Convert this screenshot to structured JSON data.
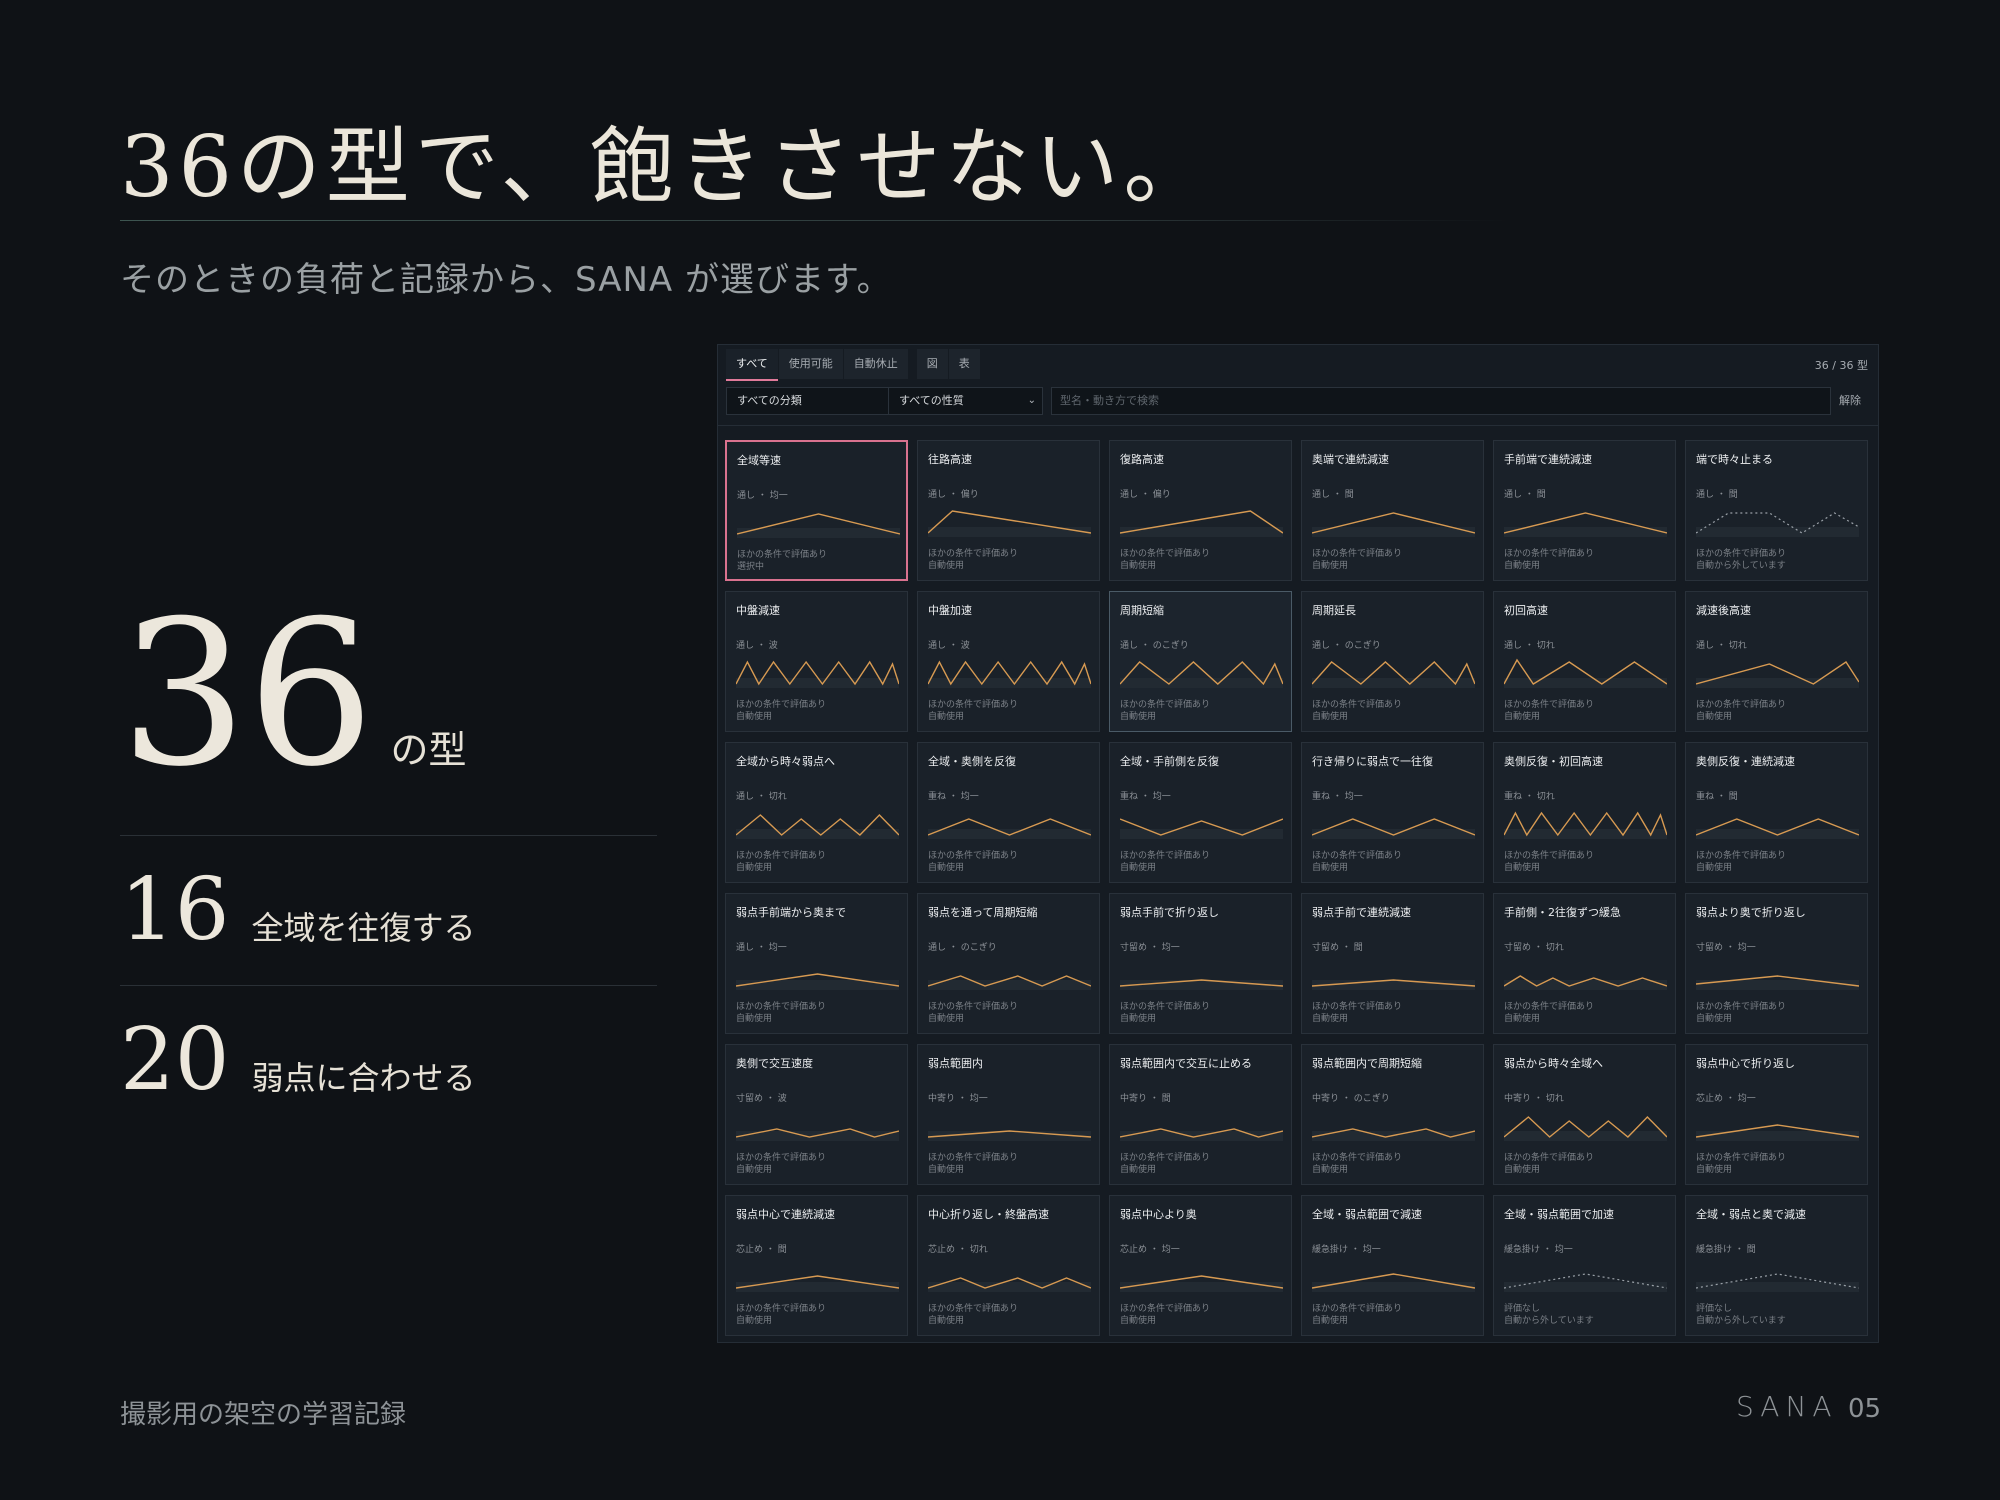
{
  "headline": "36の型で、飽きさせない。",
  "subline": "そのときの負荷と記録から、SANA が選びます。",
  "stats": {
    "total": {
      "num": "36",
      "label": "の型"
    },
    "round": {
      "num": "16",
      "label": "全域を往復する"
    },
    "weak": {
      "num": "20",
      "label": "弱点に合わせる"
    }
  },
  "footer": {
    "note": "撮影用の架空の学習記録",
    "brand": "SANA",
    "page": "05"
  },
  "colors": {
    "background": "#0f1216",
    "accent": "#e07a9a",
    "line": "#d79a52",
    "dotted": "#9aa1a8"
  },
  "panel": {
    "tabs": [
      "すべて",
      "使用可能",
      "自動休止"
    ],
    "view_tabs": [
      "図",
      "表"
    ],
    "count": "36 / 36 型",
    "category_select": "すべての分類",
    "property_select": "すべての性質",
    "search_placeholder": "型名・動き方で検索",
    "clear": "解除",
    "cards": [
      {
        "title": "全域等速",
        "sub": "通し ・ 均一",
        "e1": "ほかの条件で評価あり",
        "e2": "選択中",
        "selected": true,
        "wave": "tri"
      },
      {
        "title": "往路高速",
        "sub": "通し ・ 偏り",
        "e1": "ほかの条件で評価あり",
        "e2": "自動使用",
        "wave": "fast"
      },
      {
        "title": "復路高速",
        "sub": "通し ・ 偏り",
        "e1": "ほかの条件で評価あり",
        "e2": "自動使用",
        "wave": "slow"
      },
      {
        "title": "奥端で連続減速",
        "sub": "通し ・ 間",
        "e1": "ほかの条件で評価あり",
        "e2": "自動使用",
        "wave": "tri"
      },
      {
        "title": "手前端で連続減速",
        "sub": "通し ・ 間",
        "e1": "ほかの条件で評価あり",
        "e2": "自動使用",
        "wave": "tri"
      },
      {
        "title": "端で時々止まる",
        "sub": "通し ・ 間",
        "e1": "ほかの条件で評価あり",
        "e2": "自動から外しています",
        "wave": "dotm",
        "dotted": true
      },
      {
        "title": "中盤減速",
        "sub": "通し ・ 波",
        "e1": "ほかの条件で評価あり",
        "e2": "自動使用",
        "wave": "zig6"
      },
      {
        "title": "中盤加速",
        "sub": "通し ・ 波",
        "e1": "ほかの条件で評価あり",
        "e2": "自動使用",
        "wave": "zig6"
      },
      {
        "title": "周期短縮",
        "sub": "通し ・ のこぎり",
        "e1": "ほかの条件で評価あり",
        "e2": "自動使用",
        "hover": true,
        "wave": "zig4"
      },
      {
        "title": "周期延長",
        "sub": "通し ・ のこぎり",
        "e1": "ほかの条件で評価あり",
        "e2": "自動使用",
        "wave": "zig4"
      },
      {
        "title": "初回高速",
        "sub": "通し ・ 切れ",
        "e1": "ほかの条件で評価あり",
        "e2": "自動使用",
        "wave": "zig3"
      },
      {
        "title": "減速後高速",
        "sub": "通し ・ 切れ",
        "e1": "ほかの条件で評価あり",
        "e2": "自動使用",
        "wave": "tri2"
      },
      {
        "title": "全域から時々弱点へ",
        "sub": "通し ・ 切れ",
        "e1": "ほかの条件で評価あり",
        "e2": "自動使用",
        "wave": "zig5"
      },
      {
        "title": "全域・奥側を反復",
        "sub": "重ね ・ 均一",
        "e1": "ほかの条件で評価あり",
        "e2": "自動使用",
        "wave": "m"
      },
      {
        "title": "全域・手前側を反復",
        "sub": "重ね ・ 均一",
        "e1": "ほかの条件で評価あり",
        "e2": "自動使用",
        "wave": "w"
      },
      {
        "title": "行き帰りに弱点で一往復",
        "sub": "重ね ・ 均一",
        "e1": "ほかの条件で評価あり",
        "e2": "自動使用",
        "wave": "m"
      },
      {
        "title": "奥側反復・初回高速",
        "sub": "重ね ・ 切れ",
        "e1": "ほかの条件で評価あり",
        "e2": "自動使用",
        "wave": "zig6"
      },
      {
        "title": "奥側反復・連続減速",
        "sub": "重ね ・ 間",
        "e1": "ほかの条件で評価あり",
        "e2": "自動使用",
        "wave": "m"
      },
      {
        "title": "弱点手前端から奥まで",
        "sub": "通し ・ 均一",
        "e1": "ほかの条件で評価あり",
        "e2": "自動使用",
        "wave": "low"
      },
      {
        "title": "弱点を通って周期短縮",
        "sub": "通し ・ のこぎり",
        "e1": "ほかの条件で評価あり",
        "e2": "自動使用",
        "wave": "lowzig"
      },
      {
        "title": "弱点手前で折り返し",
        "sub": "寸留め ・ 均一",
        "e1": "ほかの条件で評価あり",
        "e2": "自動使用",
        "wave": "flat"
      },
      {
        "title": "弱点手前で連続減速",
        "sub": "寸留め ・ 間",
        "e1": "ほかの条件で評価あり",
        "e2": "自動使用",
        "wave": "flat"
      },
      {
        "title": "手前側・2往復ずつ緩急",
        "sub": "寸留め ・ 切れ",
        "e1": "ほかの条件で評価あり",
        "e2": "自動使用",
        "wave": "smallzig"
      },
      {
        "title": "弱点より奥で折り返し",
        "sub": "寸留め ・ 均一",
        "e1": "ほかの条件で評価あり",
        "e2": "自動使用",
        "wave": "flat2"
      },
      {
        "title": "奥側で交互速度",
        "sub": "寸留め ・ 波",
        "e1": "ほかの条件で評価あり",
        "e2": "自動使用",
        "wave": "smallzig2"
      },
      {
        "title": "弱点範囲内",
        "sub": "中寄り ・ 均一",
        "e1": "ほかの条件で評価あり",
        "e2": "自動使用",
        "wave": "flat"
      },
      {
        "title": "弱点範囲内で交互に止める",
        "sub": "中寄り ・ 間",
        "e1": "ほかの条件で評価あり",
        "e2": "自動使用",
        "wave": "smallzig2"
      },
      {
        "title": "弱点範囲内で周期短縮",
        "sub": "中寄り ・ のこぎり",
        "e1": "ほかの条件で評価あり",
        "e2": "自動使用",
        "wave": "smallzig2"
      },
      {
        "title": "弱点から時々全域へ",
        "sub": "中寄り ・ 切れ",
        "e1": "ほかの条件で評価あり",
        "e2": "自動使用",
        "wave": "zig5"
      },
      {
        "title": "弱点中心で折り返し",
        "sub": "芯止め ・ 均一",
        "e1": "ほかの条件で評価あり",
        "e2": "自動使用",
        "wave": "low"
      },
      {
        "title": "弱点中心で連続減速",
        "sub": "芯止め ・ 間",
        "e1": "ほかの条件で評価あり",
        "e2": "自動使用",
        "wave": "low"
      },
      {
        "title": "中心折り返し・終盤高速",
        "sub": "芯止め ・ 切れ",
        "e1": "ほかの条件で評価あり",
        "e2": "自動使用",
        "wave": "lowzig"
      },
      {
        "title": "弱点中心より奥",
        "sub": "芯止め ・ 均一",
        "e1": "ほかの条件で評価あり",
        "e2": "自動使用",
        "wave": "low"
      },
      {
        "title": "全域・弱点範囲で減速",
        "sub": "緩急掛け ・ 均一",
        "e1": "ほかの条件で評価あり",
        "e2": "自動使用",
        "wave": "lowtri"
      },
      {
        "title": "全域・弱点範囲で加速",
        "sub": "緩急掛け ・ 均一",
        "e1": "評価なし",
        "e2": "自動から外しています",
        "wave": "lowtri",
        "dotted": true
      },
      {
        "title": "全域・弱点と奥で減速",
        "sub": "緩急掛け ・ 間",
        "e1": "評価なし",
        "e2": "自動から外しています",
        "wave": "lowtri",
        "dotted": true
      }
    ]
  }
}
